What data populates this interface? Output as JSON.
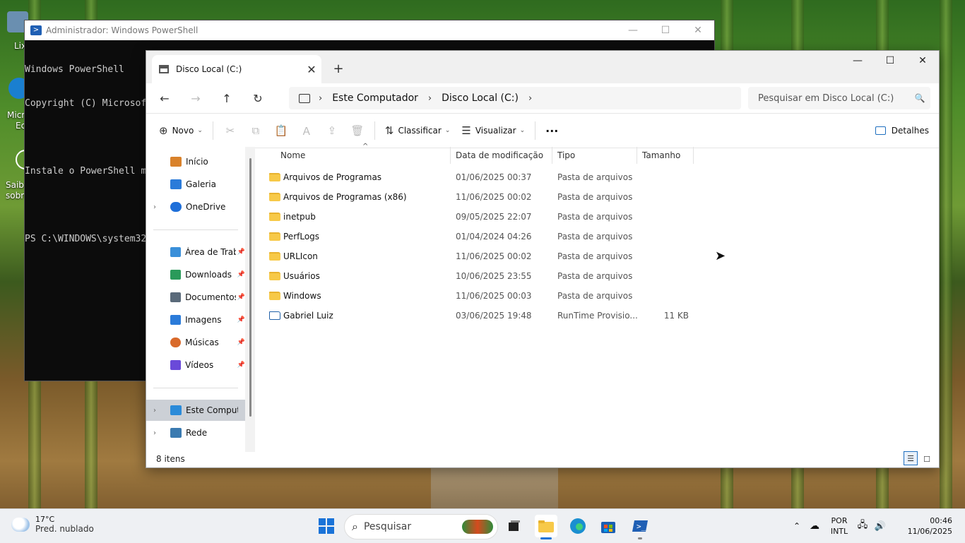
{
  "desktop": {
    "labels": [
      "Lix",
      "Micr",
      "Ec",
      "Saiba",
      "sobre"
    ]
  },
  "powershell": {
    "title": "Administrador: Windows PowerShell",
    "lines": [
      "Windows PowerShell",
      "Copyright (C) Microsoft",
      "",
      "Instale o PowerShell m",
      "",
      "PS C:\\WINDOWS\\system32"
    ],
    "controls": {
      "minimize": "—",
      "maximize": "☐",
      "close": "✕"
    }
  },
  "explorer": {
    "tab_title": "Disco Local (C:)",
    "tab_close": "✕",
    "tab_new": "+",
    "controls": {
      "minimize": "—",
      "maximize": "☐",
      "close": "✕"
    },
    "nav": {
      "back": "←",
      "forward": "→",
      "up": "↑",
      "refresh": "↻"
    },
    "breadcrumb": [
      "Este Computador",
      "Disco Local (C:)"
    ],
    "breadcrumb_sep": "›",
    "search_placeholder": "Pesquisar em Disco Local (C:)",
    "commands": {
      "new": "Novo",
      "sort": "Classificar",
      "view": "Visualizar",
      "more": "···",
      "details": "Detalhes"
    },
    "sidebar": [
      {
        "label": "Início",
        "expand": "",
        "pin": "",
        "color": "#d9822b"
      },
      {
        "label": "Galeria",
        "expand": "",
        "pin": "",
        "color": "#2b7bd9"
      },
      {
        "label": "OneDrive",
        "expand": "›",
        "pin": "",
        "color": "#1e6fd9"
      },
      {
        "label": "Área de Trabalho",
        "expand": "",
        "pin": "📌",
        "color": "#3a8fd9"
      },
      {
        "label": "Downloads",
        "expand": "",
        "pin": "📌",
        "color": "#2a9a5a"
      },
      {
        "label": "Documentos",
        "expand": "",
        "pin": "📌",
        "color": "#5a6a7a"
      },
      {
        "label": "Imagens",
        "expand": "",
        "pin": "📌",
        "color": "#2b7bd9"
      },
      {
        "label": "Músicas",
        "expand": "",
        "pin": "📌",
        "color": "#d96a2b"
      },
      {
        "label": "Vídeos",
        "expand": "",
        "pin": "📌",
        "color": "#6a4ad9"
      },
      {
        "label": "Este Computador",
        "expand": "›",
        "pin": "",
        "color": "#2b8bd9"
      },
      {
        "label": "Rede",
        "expand": "›",
        "pin": "",
        "color": "#3a7ab0"
      }
    ],
    "columns": {
      "name": "Nome",
      "date": "Data de modificação",
      "type": "Tipo",
      "size": "Tamanho"
    },
    "files": [
      {
        "name": "Arquivos de Programas",
        "date": "01/06/2025 00:37",
        "type": "Pasta de arquivos",
        "size": "",
        "kind": "folder"
      },
      {
        "name": "Arquivos de Programas (x86)",
        "date": "11/06/2025 00:02",
        "type": "Pasta de arquivos",
        "size": "",
        "kind": "folder"
      },
      {
        "name": "inetpub",
        "date": "09/05/2025 22:07",
        "type": "Pasta de arquivos",
        "size": "",
        "kind": "folder"
      },
      {
        "name": "PerfLogs",
        "date": "01/04/2024 04:26",
        "type": "Pasta de arquivos",
        "size": "",
        "kind": "folder"
      },
      {
        "name": "URLIcon",
        "date": "11/06/2025 00:02",
        "type": "Pasta de arquivos",
        "size": "",
        "kind": "folder"
      },
      {
        "name": "Usuários",
        "date": "10/06/2025 23:55",
        "type": "Pasta de arquivos",
        "size": "",
        "kind": "folder"
      },
      {
        "name": "Windows",
        "date": "11/06/2025 00:03",
        "type": "Pasta de arquivos",
        "size": "",
        "kind": "folder"
      },
      {
        "name": "Gabriel Luiz",
        "date": "03/06/2025 19:48",
        "type": "RunTime Provisio...",
        "size": "11 KB",
        "kind": "file"
      }
    ],
    "status": "8 itens"
  },
  "taskbar": {
    "weather_temp": "17°C",
    "weather_desc": "Pred. nublado",
    "search_placeholder": "Pesquisar",
    "lang_line1": "POR",
    "lang_line2": "INTL",
    "time": "00:46",
    "date": "11/06/2025"
  }
}
